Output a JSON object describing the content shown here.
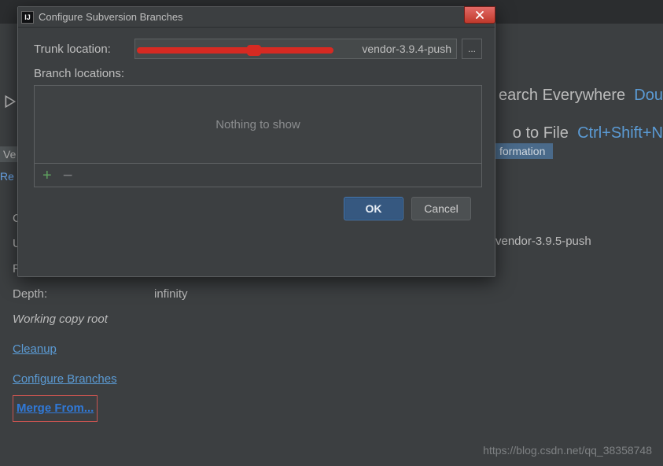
{
  "ide": {
    "partial_left_top": "Ve",
    "partial_left_link": "Re",
    "right_row1_text": "earch Everywhere",
    "right_row1_link": "Dou",
    "right_row2_text": "o to File",
    "right_row2_link": "Ctrl+Shift+N",
    "tab_label": "formation",
    "vendor_text": "vendor-3.9.5-push"
  },
  "info": {
    "c_partial": "C",
    "u_partial": "U",
    "f_partial": "F",
    "depth_label": "Depth:",
    "depth_value": "infinity",
    "root_label": "Working copy root",
    "links": {
      "cleanup": "Cleanup",
      "configure": "Configure Branches",
      "merge": "Merge From..."
    }
  },
  "dialog": {
    "title": "Configure Subversion Branches",
    "app_icon_text": "IJ",
    "trunk_label": "Trunk location:",
    "trunk_value_suffix": "vendor-3.9.4-push",
    "ellipsis": "...",
    "branch_label": "Branch locations:",
    "empty_text": "Nothing to show",
    "add_label": "+",
    "remove_label": "−",
    "ok": "OK",
    "cancel": "Cancel"
  },
  "watermark": "https://blog.csdn.net/qq_38358748"
}
